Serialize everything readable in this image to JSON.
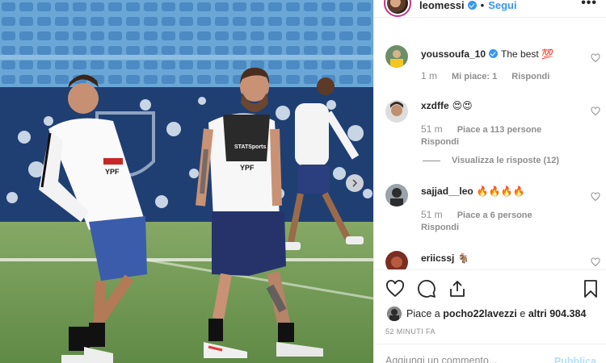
{
  "post": {
    "username": "leomessi",
    "separator": "•",
    "follow_label": "Segui",
    "more_label": "•••"
  },
  "comments": [
    {
      "username": "youssoufa_10",
      "verified": true,
      "text": "The best 💯",
      "time": "1 m",
      "likes": "Mi piace: 1",
      "reply": "Rispondi"
    },
    {
      "username": "xzdffe",
      "text": "😍😍",
      "time": "51 m",
      "likes": "Piace a 113 persone",
      "reply": "Rispondi",
      "view_replies": "Visualizza le risposte (12)"
    },
    {
      "username": "sajjad__leo",
      "text": "🔥🔥🔥🔥",
      "time": "51 m",
      "likes": "Piace a 6 persone",
      "reply": "Rispondi"
    },
    {
      "username": "eriicssj",
      "text": "🐐"
    }
  ],
  "likes_summary": {
    "prefix": "Piace a",
    "user": "pocho22lavezzi",
    "connector": "e",
    "others": "altri 904.384"
  },
  "time_ago": "52 MINUTI FA",
  "comment_box": {
    "placeholder": "Aggiungi un commento...",
    "publish_label": "Pubblica"
  },
  "icons": {
    "like": "heart-icon",
    "comment": "comment-icon",
    "share": "share-icon",
    "save": "bookmark-icon",
    "next": "chevron-right-icon"
  },
  "colors": {
    "accent": "#3897f0",
    "muted": "#8e8e8e",
    "text": "#262626",
    "publish_disabled": "#b2dffc"
  }
}
